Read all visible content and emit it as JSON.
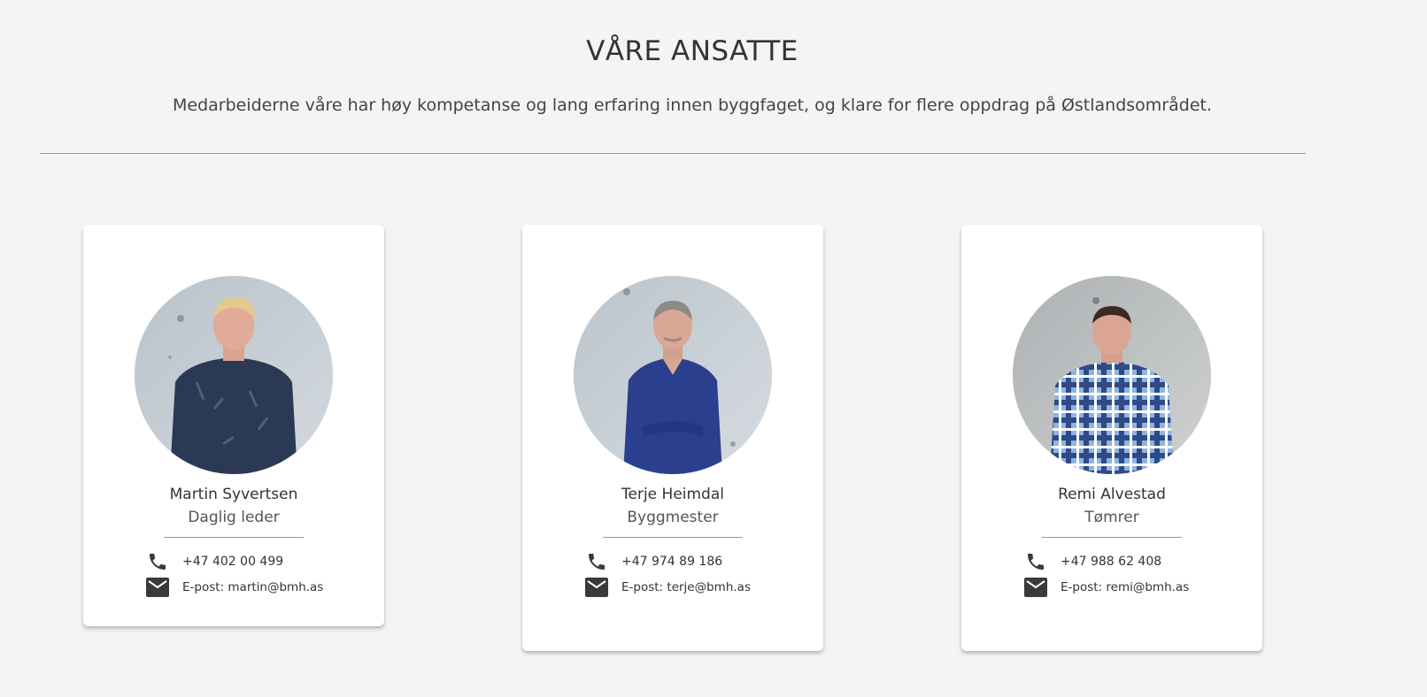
{
  "section": {
    "title": "VÅRE ANSATTE",
    "intro": "Medarbeiderne våre har høy kompetanse og lang erfaring innen byggfaget, og klare for flere oppdrag på Østlandsområdet."
  },
  "employees": [
    {
      "name": "Martin Syvertsen",
      "role": "Daglig leder",
      "phone": "+47 402 00 499",
      "email": "E-post: martin@bmh.as",
      "photo": "portrait-photo"
    },
    {
      "name": "Terje Heimdal",
      "role": "Byggmester",
      "phone": "+47 974 89 186",
      "email": "E-post: terje@bmh.as",
      "photo": "portrait-photo"
    },
    {
      "name": "Remi Alvestad",
      "role": "Tømrer",
      "phone": "+47 988 62 408",
      "email": "E-post: remi@bmh.as",
      "photo": "portrait-photo"
    }
  ],
  "icons": {
    "phone": "phone-icon",
    "email": "mail-icon"
  },
  "colors": {
    "background": "#f4f4f4",
    "card": "#ffffff",
    "text": "#333333",
    "icon": "#3a3a3a"
  }
}
